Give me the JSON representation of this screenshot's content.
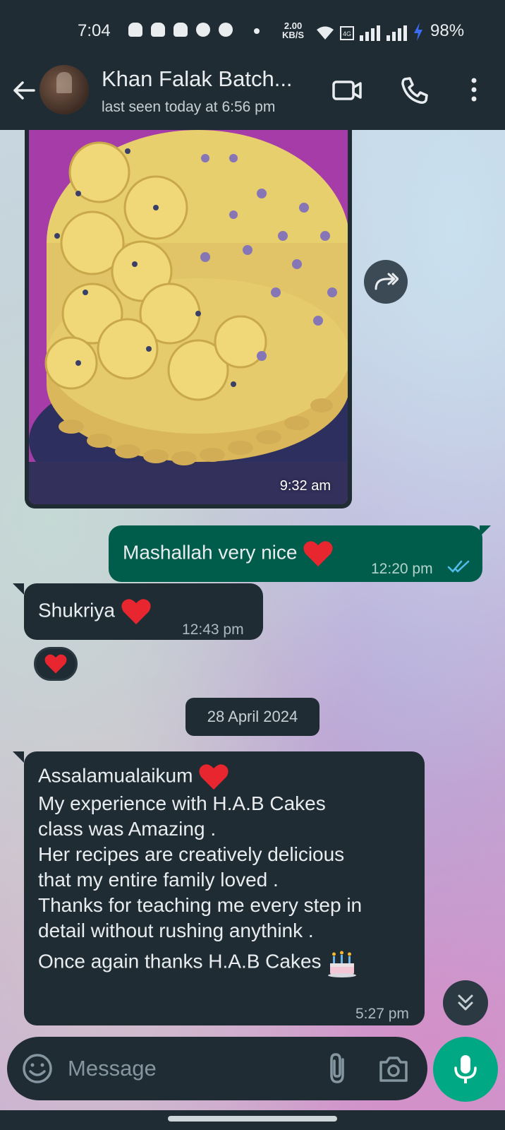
{
  "status_bar": {
    "time": "7:04",
    "speed_value": "2.00",
    "speed_unit": "KB/S",
    "battery": "98%",
    "notification_icons": [
      "snapchat-icon",
      "snapchat-icon",
      "snapchat-icon",
      "facebook-icon",
      "facebook-icon"
    ]
  },
  "header": {
    "title": "Khan Falak Batch...",
    "subtitle": "last seen today at 6:56 pm",
    "icons": [
      "back-arrow-icon",
      "video-call-icon",
      "voice-call-icon",
      "more-options-icon"
    ]
  },
  "messages": {
    "image_msg": {
      "time": "9:32 am"
    },
    "out_msg": {
      "text": "Mashallah very nice",
      "time": "12:20 pm",
      "status": "read"
    },
    "in_msg": {
      "text": "Shukriya",
      "time": "12:43 pm",
      "reaction": "❤️"
    },
    "date_divider": "28 April 2024",
    "long_msg": {
      "lines": [
        "Assalamualaikum",
        "My experience with H.A.B  Cakes",
        "class was Amazing .",
        "Her recipes are creatively delicious",
        "that my entire family loved .",
        "Thanks for teaching me every step in",
        "detail without rushing anythink .",
        "Once again thanks H.A.B Cakes"
      ],
      "time": "5:27 pm"
    }
  },
  "composer": {
    "placeholder": "Message"
  },
  "colors": {
    "header_bg": "#1f2c34",
    "outgoing_bubble": "#005c4b",
    "incoming_bubble": "#1f2c34",
    "accent": "#00a884",
    "read_ticks": "#53bdeb"
  }
}
